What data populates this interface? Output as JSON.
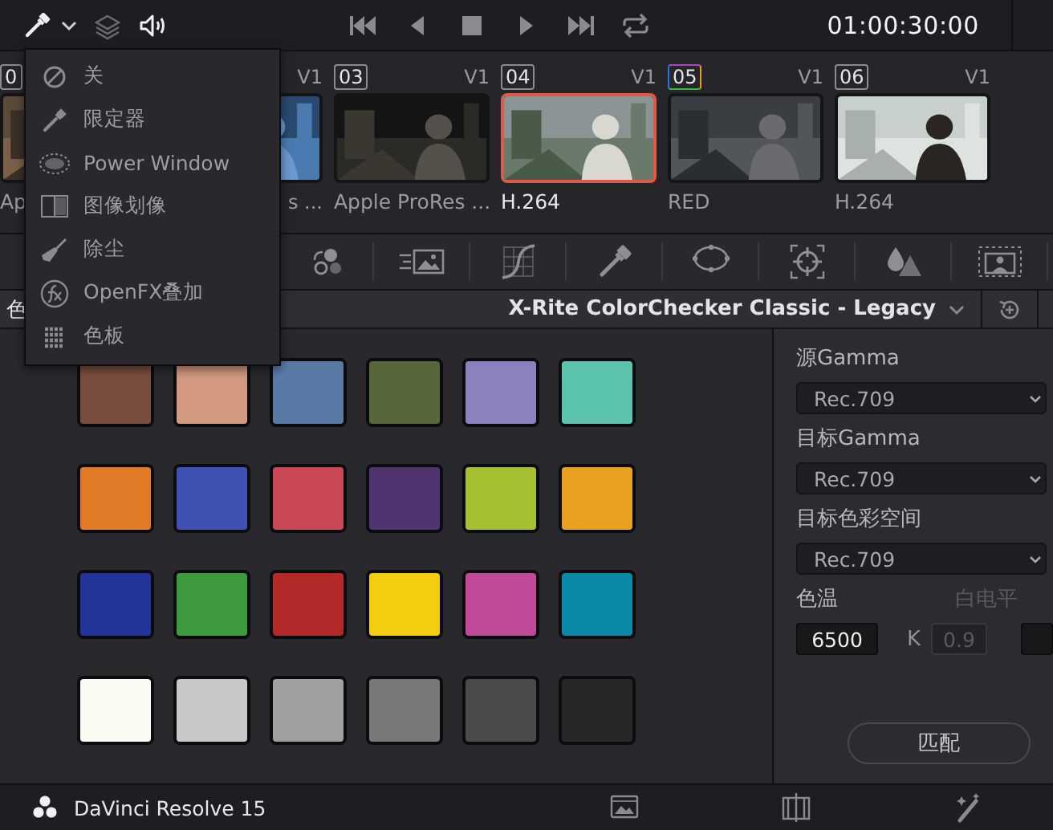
{
  "top_bar": {
    "tools": [
      {
        "kind": "eyedropper",
        "active": true,
        "menu": true
      },
      {
        "kind": "layers",
        "active": false,
        "menu": false
      },
      {
        "kind": "speaker",
        "active": true,
        "menu": false
      }
    ],
    "transport": [
      {
        "kind": "skip-back"
      },
      {
        "kind": "reverse"
      },
      {
        "kind": "stop"
      },
      {
        "kind": "play"
      },
      {
        "kind": "skip-forward"
      },
      {
        "kind": "loop"
      }
    ],
    "timecode": "01:00:30:00"
  },
  "clips": [
    {
      "number": "0",
      "label": "Ap",
      "selected": false,
      "flagged": false,
      "cut": false
    },
    {
      "track": "V1",
      "label": "s ...",
      "selected": false,
      "flagged": false,
      "cut": true
    },
    {
      "number": "03",
      "track": "V1",
      "label": "Apple ProRes ...",
      "selected": false,
      "flagged": false,
      "cut": false
    },
    {
      "number": "04",
      "track": "V1",
      "label": "H.264",
      "selected": true,
      "flagged": false,
      "cut": false
    },
    {
      "number": "05",
      "track": "V1",
      "label": "RED",
      "selected": false,
      "flagged": true,
      "cut": false
    },
    {
      "number": "06",
      "track": "V1",
      "label": "H.264",
      "selected": false,
      "flagged": false,
      "cut": false
    }
  ],
  "tool_strip": [
    {
      "kind": "nodes"
    },
    {
      "kind": "motion"
    },
    {
      "kind": "curves"
    },
    {
      "kind": "qualifier"
    },
    {
      "kind": "window"
    },
    {
      "kind": "tracker"
    },
    {
      "kind": "blur"
    },
    {
      "kind": "key"
    }
  ],
  "panel_header": {
    "tab": "色",
    "title": "X-Rite ColorChecker Classic - Legacy"
  },
  "swatches": [
    {
      "color": "#7a4e3e"
    },
    {
      "color": "#d39a80"
    },
    {
      "color": "#5a7aa6"
    },
    {
      "color": "#56683a"
    },
    {
      "color": "#8a82bc"
    },
    {
      "color": "#5cc4ae"
    },
    {
      "color": "#e07a24"
    },
    {
      "color": "#3f52b4"
    },
    {
      "color": "#c84858"
    },
    {
      "color": "#503470"
    },
    {
      "color": "#a4c030"
    },
    {
      "color": "#eaa020"
    },
    {
      "color": "#22349a"
    },
    {
      "color": "#3e9a3e"
    },
    {
      "color": "#b42a2a"
    },
    {
      "color": "#f4cc10"
    },
    {
      "color": "#c04a98"
    },
    {
      "color": "#0a88a8"
    },
    {
      "color": "#fbfbf4"
    },
    {
      "color": "#c8c8c8"
    },
    {
      "color": "#a0a0a0"
    },
    {
      "color": "#787878"
    },
    {
      "color": "#4a4a4a"
    },
    {
      "color": "#262626"
    }
  ],
  "settings": {
    "dropdowns": [
      {
        "label": "源Gamma",
        "value": "Rec.709"
      },
      {
        "label": "目标Gamma",
        "value": "Rec.709"
      },
      {
        "label": "目标色彩空间",
        "value": "Rec.709"
      }
    ],
    "temperature": {
      "label": "色温",
      "value": "6500",
      "unit": "K"
    },
    "white_level": {
      "label": "白电平",
      "value": "0.9",
      "disabled": true
    },
    "match_button": "匹配"
  },
  "bottom_bar": {
    "app_name": "DaVinci Resolve 15",
    "pages": [
      {
        "kind": "gallery"
      },
      {
        "kind": "viewer"
      },
      {
        "kind": "magic"
      }
    ]
  },
  "menu": {
    "items": [
      {
        "kind": "off",
        "label": "关"
      },
      {
        "kind": "qualifier",
        "label": "限定器"
      },
      {
        "kind": "window",
        "label": "Power Window"
      },
      {
        "kind": "wipe",
        "label": "图像划像"
      },
      {
        "kind": "dust",
        "label": "除尘"
      },
      {
        "kind": "fx",
        "label": "OpenFX叠加"
      },
      {
        "kind": "grid",
        "label": "色板"
      }
    ]
  }
}
